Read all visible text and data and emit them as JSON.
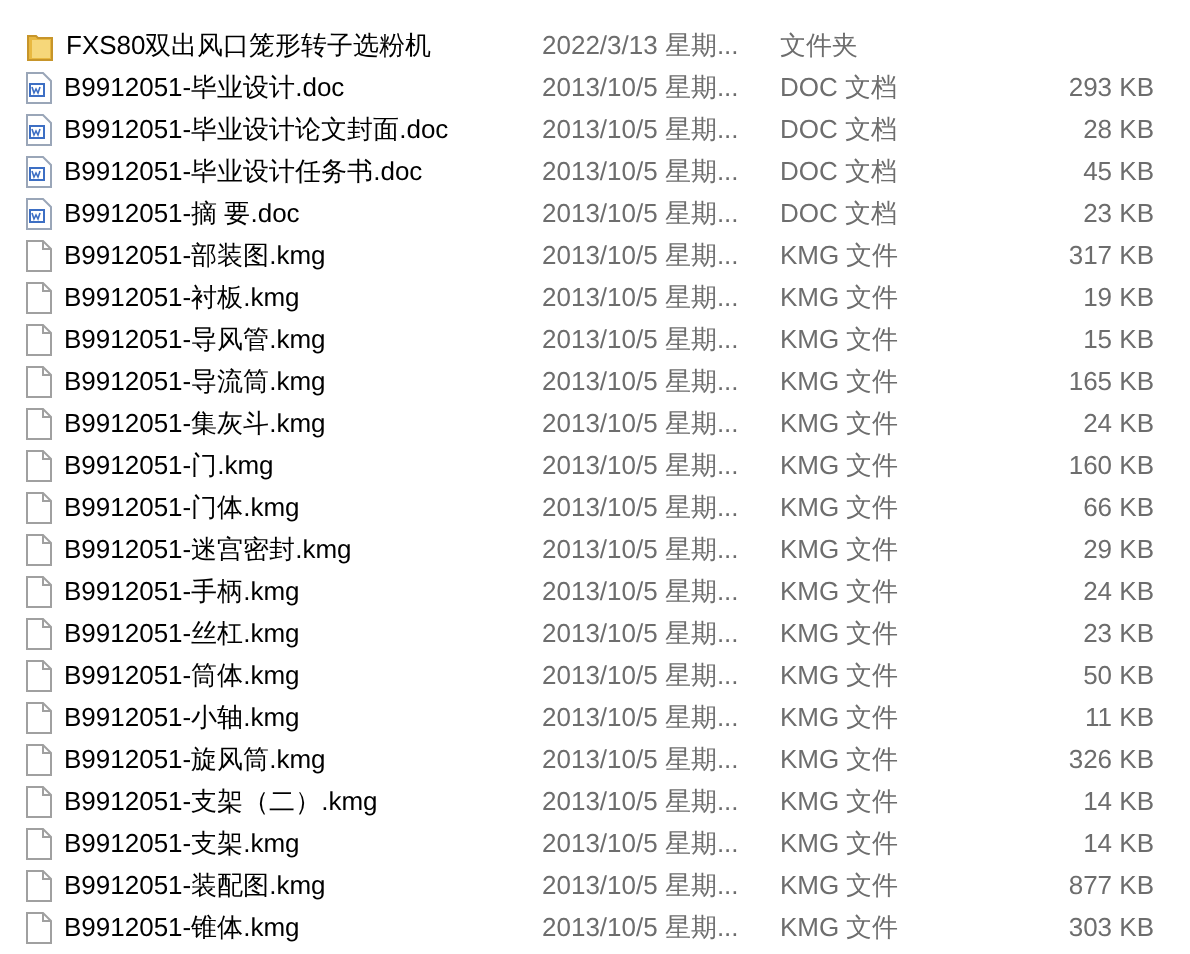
{
  "files": [
    {
      "kind": "folder",
      "name": "FXS80双出风口笼形转子选粉机",
      "date": "2022/3/13 星期...",
      "type": "文件夹"
    },
    {
      "kind": "doc",
      "name": "B9912051-毕业设计.doc",
      "date": "2013/10/5 星期...",
      "type": "DOC 文档",
      "size": "293 KB"
    },
    {
      "kind": "doc",
      "name": "B9912051-毕业设计论文封面.doc",
      "date": "2013/10/5 星期...",
      "type": "DOC 文档",
      "size": "28 KB"
    },
    {
      "kind": "doc",
      "name": "B9912051-毕业设计任务书.doc",
      "date": "2013/10/5 星期...",
      "type": "DOC 文档",
      "size": "45 KB"
    },
    {
      "kind": "doc",
      "name": "B9912051-摘 要.doc",
      "date": "2013/10/5 星期...",
      "type": "DOC 文档",
      "size": "23 KB"
    },
    {
      "kind": "file",
      "name": "B9912051-部装图.kmg",
      "date": "2013/10/5 星期...",
      "type": "KMG 文件",
      "size": "317 KB"
    },
    {
      "kind": "file",
      "name": "B9912051-衬板.kmg",
      "date": "2013/10/5 星期...",
      "type": "KMG 文件",
      "size": "19 KB"
    },
    {
      "kind": "file",
      "name": "B9912051-导风管.kmg",
      "date": "2013/10/5 星期...",
      "type": "KMG 文件",
      "size": "15 KB"
    },
    {
      "kind": "file",
      "name": "B9912051-导流筒.kmg",
      "date": "2013/10/5 星期...",
      "type": "KMG 文件",
      "size": "165 KB"
    },
    {
      "kind": "file",
      "name": "B9912051-集灰斗.kmg",
      "date": "2013/10/5 星期...",
      "type": "KMG 文件",
      "size": "24 KB"
    },
    {
      "kind": "file",
      "name": "B9912051-门.kmg",
      "date": "2013/10/5 星期...",
      "type": "KMG 文件",
      "size": "160 KB"
    },
    {
      "kind": "file",
      "name": "B9912051-门体.kmg",
      "date": "2013/10/5 星期...",
      "type": "KMG 文件",
      "size": "66 KB"
    },
    {
      "kind": "file",
      "name": "B9912051-迷宫密封.kmg",
      "date": "2013/10/5 星期...",
      "type": "KMG 文件",
      "size": "29 KB"
    },
    {
      "kind": "file",
      "name": "B9912051-手柄.kmg",
      "date": "2013/10/5 星期...",
      "type": "KMG 文件",
      "size": "24 KB"
    },
    {
      "kind": "file",
      "name": "B9912051-丝杠.kmg",
      "date": "2013/10/5 星期...",
      "type": "KMG 文件",
      "size": "23 KB"
    },
    {
      "kind": "file",
      "name": "B9912051-筒体.kmg",
      "date": "2013/10/5 星期...",
      "type": "KMG 文件",
      "size": "50 KB"
    },
    {
      "kind": "file",
      "name": "B9912051-小轴.kmg",
      "date": "2013/10/5 星期...",
      "type": "KMG 文件",
      "size": "11 KB"
    },
    {
      "kind": "file",
      "name": "B9912051-旋风筒.kmg",
      "date": "2013/10/5 星期...",
      "type": "KMG 文件",
      "size": "326 KB"
    },
    {
      "kind": "file",
      "name": "B9912051-支架（二）.kmg",
      "date": "2013/10/5 星期...",
      "type": "KMG 文件",
      "size": "14 KB"
    },
    {
      "kind": "file",
      "name": "B9912051-支架.kmg",
      "date": "2013/10/5 星期...",
      "type": "KMG 文件",
      "size": "14 KB"
    },
    {
      "kind": "file",
      "name": "B9912051-装配图.kmg",
      "date": "2013/10/5 星期...",
      "type": "KMG 文件",
      "size": "877 KB"
    },
    {
      "kind": "file",
      "name": "B9912051-锥体.kmg",
      "date": "2013/10/5 星期...",
      "type": "KMG 文件",
      "size": "303 KB"
    }
  ]
}
